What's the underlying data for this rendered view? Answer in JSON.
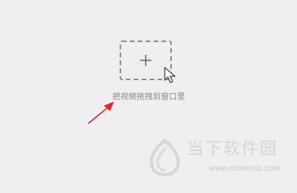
{
  "drop_area": {
    "hint": "把视频拖拽到窗口里",
    "plus_icon": "plus-icon",
    "cursor_icon": "mouse-pointer-icon"
  },
  "annotation": {
    "arrow_icon": "red-arrow-icon",
    "color": "#e3262a"
  },
  "watermark": {
    "name": "当下软件园",
    "url": "www.downxia.com",
    "logo_icon": "downxia-logo-icon"
  }
}
